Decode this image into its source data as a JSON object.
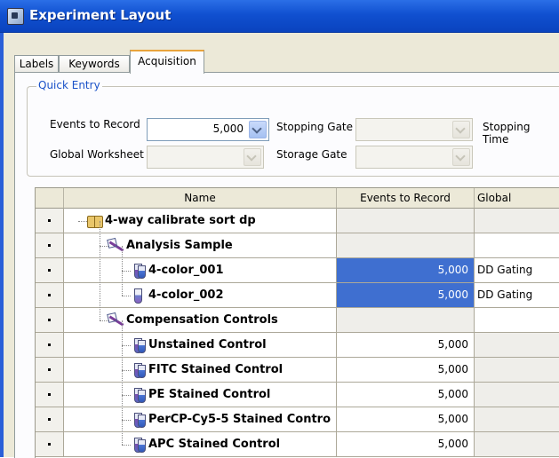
{
  "window": {
    "title": "Experiment Layout"
  },
  "tabs": [
    {
      "label": "Labels",
      "active": false
    },
    {
      "label": "Keywords",
      "active": false
    },
    {
      "label": "Acquisition",
      "active": true
    }
  ],
  "quick_entry": {
    "legend": "Quick Entry",
    "events_to_record_label": "Events to Record",
    "events_to_record_value": "5,000",
    "stopping_gate_label": "Stopping Gate",
    "stopping_gate_value": "",
    "stopping_time_label": "Stopping Time",
    "global_worksheet_label": "Global Worksheet",
    "global_worksheet_value": "",
    "storage_gate_label": "Storage Gate",
    "storage_gate_value": ""
  },
  "grid": {
    "columns": [
      "Name",
      "Events to Record",
      "Global Worksh..."
    ],
    "rows": [
      {
        "name": "4-way calibrate sort dp",
        "events": "",
        "worksheet": "",
        "level": 0,
        "icon": "experiment-book-icon",
        "events_bg": "grey",
        "ws_bg": "grey"
      },
      {
        "name": "Analysis Sample",
        "events": "",
        "worksheet": "",
        "level": 1,
        "icon": "specimen-wand-icon",
        "events_bg": "grey",
        "ws_bg": "white"
      },
      {
        "name": "4-color_001",
        "events": "5,000",
        "worksheet": "DD Gating",
        "level": 2,
        "icon": "tube-pair-icon",
        "events_bg": "selected",
        "ws_bg": "white"
      },
      {
        "name": "4-color_002",
        "events": "5,000",
        "worksheet": "DD Gating",
        "level": 2,
        "icon": "tube-icon",
        "events_bg": "selected",
        "ws_bg": "white"
      },
      {
        "name": "Compensation Controls",
        "events": "",
        "worksheet": "",
        "level": 1,
        "icon": "specimen-wand-icon",
        "events_bg": "grey",
        "ws_bg": "white"
      },
      {
        "name": "Unstained Control",
        "events": "5,000",
        "worksheet": "",
        "level": 2,
        "icon": "tube-pair-icon",
        "events_bg": "white",
        "ws_bg": "grey"
      },
      {
        "name": "FITC Stained Control",
        "events": "5,000",
        "worksheet": "",
        "level": 2,
        "icon": "tube-pair-icon",
        "events_bg": "white",
        "ws_bg": "grey"
      },
      {
        "name": "PE Stained Control",
        "events": "5,000",
        "worksheet": "",
        "level": 2,
        "icon": "tube-pair-icon",
        "events_bg": "white",
        "ws_bg": "grey"
      },
      {
        "name": "PerCP-Cy5-5 Stained Contro",
        "events": "5,000",
        "worksheet": "",
        "level": 2,
        "icon": "tube-pair-icon",
        "events_bg": "white",
        "ws_bg": "grey"
      },
      {
        "name": "APC Stained Control",
        "events": "5,000",
        "worksheet": "",
        "level": 2,
        "icon": "tube-pair-icon",
        "events_bg": "white",
        "ws_bg": "grey"
      }
    ]
  },
  "colors": {
    "title_bar": "#0a43be",
    "selection": "#3f6fd0",
    "tab_highlight": "#e8a33c",
    "legend_text": "#1a52c8"
  }
}
